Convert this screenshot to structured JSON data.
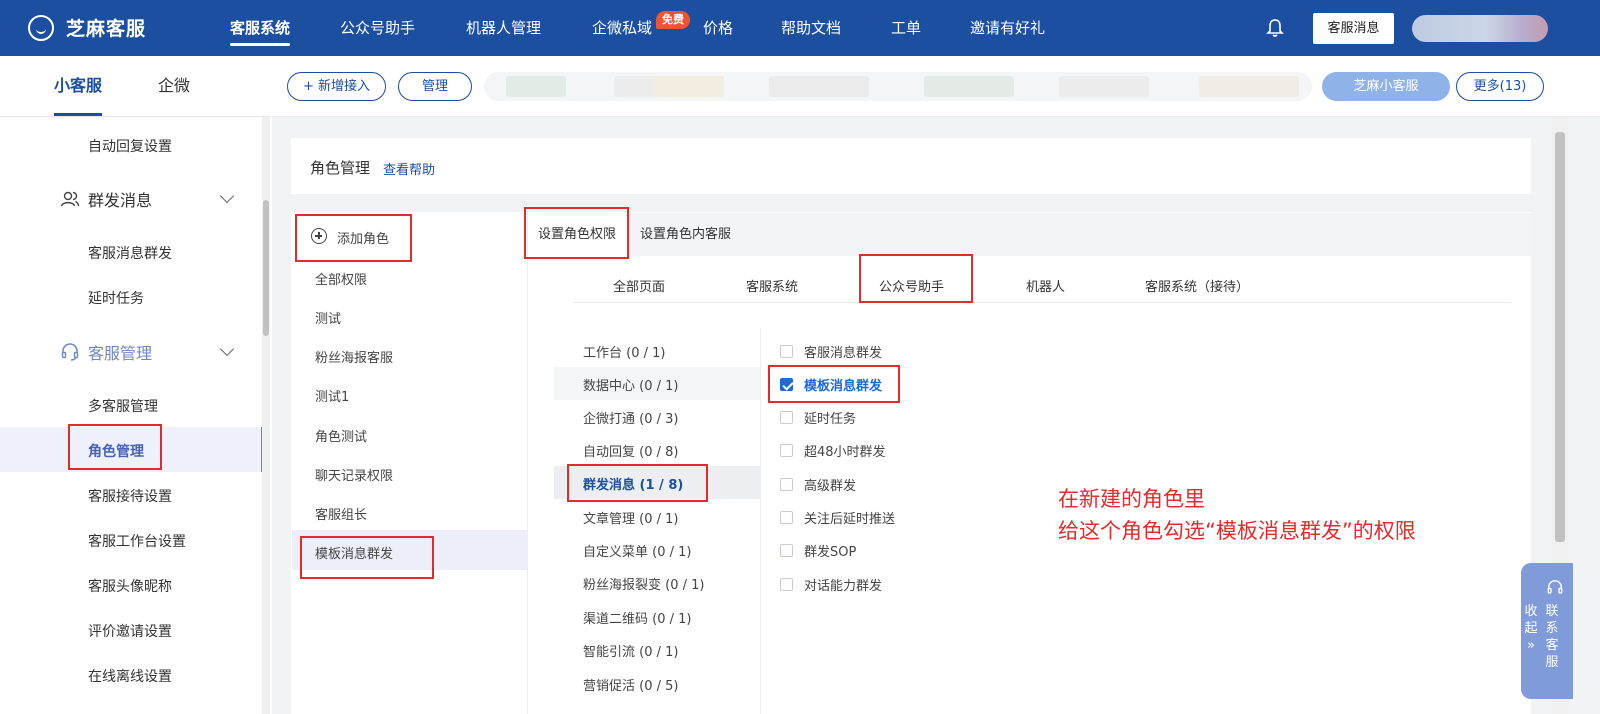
{
  "topbar": {
    "brand": "芝麻客服",
    "nav": [
      "客服系统",
      "公众号助手",
      "机器人管理",
      "企微私域",
      "价格",
      "帮助文档",
      "工单",
      "邀请有好礼"
    ],
    "free_badge": "免费",
    "kf_msg_btn": "客服消息"
  },
  "subbar": {
    "tabs": [
      "小客服",
      "企微"
    ],
    "add_access": "+ 新增接入",
    "manage": "管理",
    "zhima_btn": "芝麻小客服",
    "more": "更多(13)"
  },
  "sidebar": {
    "auto_reply": "自动回复设置",
    "group_send": "群发消息",
    "kf_msg_group": "客服消息群发",
    "delay_task": "延时任务",
    "kf_manage": "客服管理",
    "multi_kf": "多客服管理",
    "role_manage": "角色管理",
    "reception": "客服接待设置",
    "workbench": "客服工作台设置",
    "avatar_nick": "客服头像昵称",
    "review_invite": "评价邀请设置",
    "online_offline": "在线离线设置"
  },
  "page": {
    "title": "角色管理",
    "help": "查看帮助"
  },
  "roles": {
    "add": "添加角色",
    "items": [
      "全部权限",
      "测试",
      "粉丝海报客服",
      "测试1",
      "角色测试",
      "聊天记录权限",
      "客服组长",
      "模板消息群发"
    ]
  },
  "tabs": [
    "设置角色权限",
    "设置角色内客服"
  ],
  "perm_tabs": [
    "全部页面",
    "客服系统",
    "公众号助手",
    "机器人",
    "客服系统（接待）"
  ],
  "modules": [
    "工作台 (0 / 1)",
    "数据中心 (0 / 1)",
    "企微打通 (0 / 3)",
    "自动回复 (0 / 8)",
    "群发消息 (1 / 8)",
    "文章管理 (0 / 1)",
    "自定义菜单 (0 / 1)",
    "粉丝海报裂变 (0 / 1)",
    "渠道二维码 (0 / 1)",
    "智能引流 (0 / 1)",
    "营销促活 (0 / 5)"
  ],
  "permissions": [
    {
      "label": "客服消息群发",
      "checked": false
    },
    {
      "label": "模板消息群发",
      "checked": true
    },
    {
      "label": "延时任务",
      "checked": false
    },
    {
      "label": "超48小时群发",
      "checked": false
    },
    {
      "label": "高级群发",
      "checked": false
    },
    {
      "label": "关注后延时推送",
      "checked": false
    },
    {
      "label": "群发SOP",
      "checked": false
    },
    {
      "label": "对话能力群发",
      "checked": false
    }
  ],
  "annotation": {
    "line1": "在新建的角色里",
    "line2": "给这个角色勾选“模板消息群发”的权限"
  },
  "contact": {
    "collapse": [
      "收",
      "起",
      "»"
    ],
    "contact": [
      "联",
      "系",
      "客",
      "服"
    ]
  },
  "colors": {
    "brand": "#1c4fa0",
    "annotation": "#e22c2c",
    "checkbox_on": "#1c6ad8"
  }
}
